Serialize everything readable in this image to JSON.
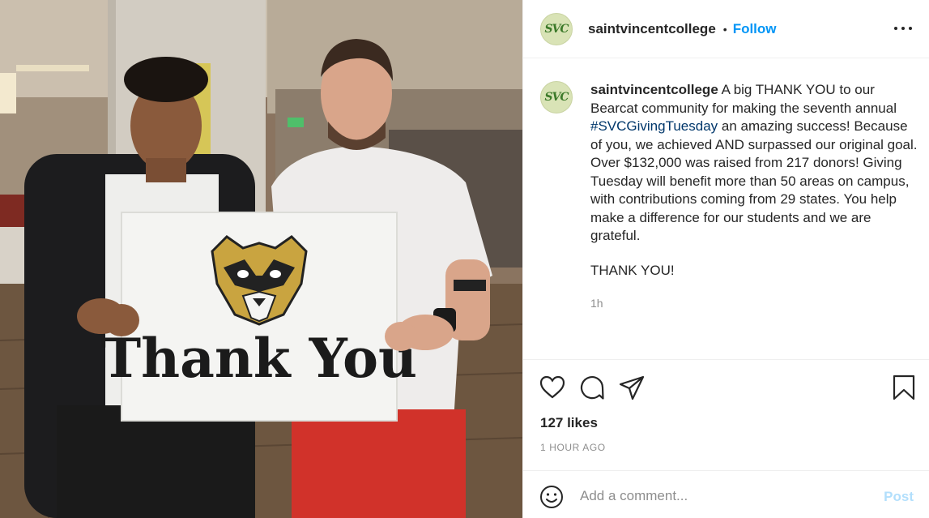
{
  "photo": {
    "sign_text": "Thank You",
    "mascot_icon": "bearcat-mascot-icon"
  },
  "account": {
    "username": "saintvincentcollege",
    "avatar_text": "SVC",
    "separator": "•",
    "follow_label": "Follow"
  },
  "caption": {
    "text_before": " A big THANK YOU to our Bearcat community for making the seventh annual ",
    "hashtag": "#SVCGivingTuesday",
    "text_after": " an amazing success! Because of you, we achieved AND surpassed our original goal. Over $132,000 was raised from 217 donors! Giving Tuesday will benefit more than 50 areas on campus, with contributions coming from 29 states. You help make a difference for our students and we are grateful.",
    "thank_you": "THANK YOU!",
    "time": "1h"
  },
  "actions": {
    "icons": [
      "heart-icon",
      "comment-icon",
      "share-icon",
      "bookmark-icon"
    ],
    "likes": "127 likes",
    "time_ago": "1 HOUR AGO"
  },
  "comment": {
    "placeholder": "Add a comment...",
    "post_label": "Post",
    "emoji_icon": "emoji-icon"
  },
  "colors": {
    "accent": "#0095f6",
    "post_disabled": "#b2dffc",
    "hashtag": "#00376b",
    "muted": "#8e8e8e"
  }
}
